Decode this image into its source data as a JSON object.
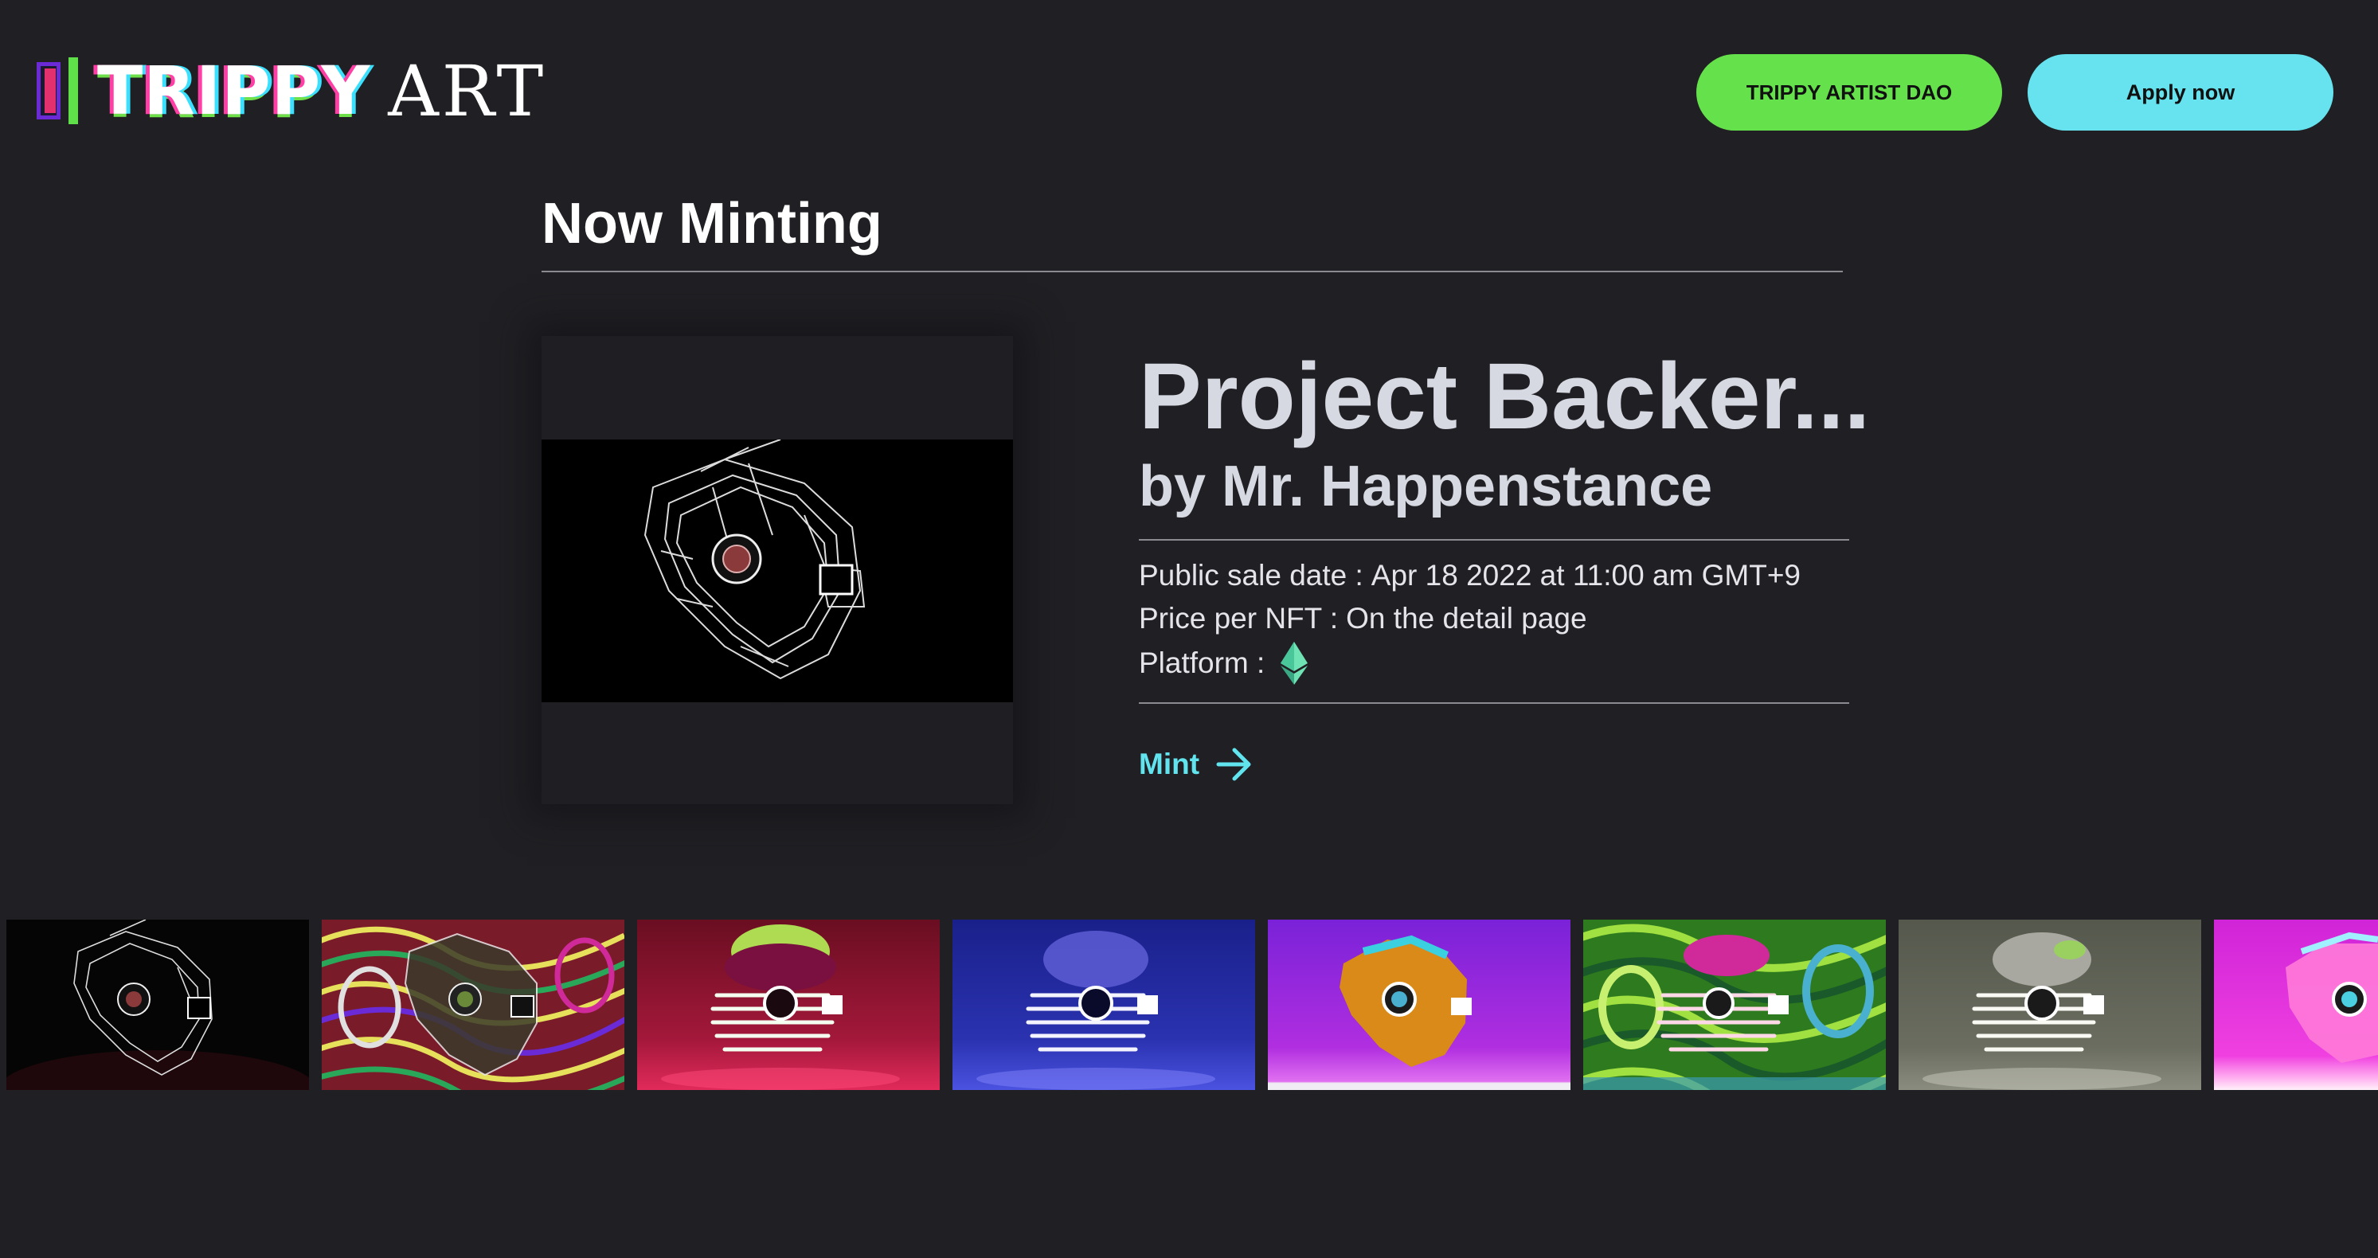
{
  "header": {
    "logo_word_1": "TRIPPY",
    "logo_word_2": "ART",
    "dao_button": "TRIPPY ARTIST DAO",
    "apply_button": "Apply now"
  },
  "section": {
    "title": "Now Minting"
  },
  "feature": {
    "title": "Project Backer...",
    "artist": "by Mr. Happenstance",
    "sale_label": "Public sale date :",
    "sale_value": "Apr 18 2022 at 11:00 am GMT+9",
    "price_label": "Price per NFT :",
    "price_value": "On the detail page",
    "platform_label": "Platform :",
    "platform_icon": "ethereum-icon",
    "mint_label": "Mint"
  },
  "thumbnails": [
    {
      "name": "sketch-black",
      "bg": "#050505",
      "accent": "#d8d8d8"
    },
    {
      "name": "swirl-rainbow",
      "bg": "#7a1b2a",
      "accent": "#e6e05a"
    },
    {
      "name": "red-neon",
      "bg": "#8a1230",
      "accent": "#b8ff5a"
    },
    {
      "name": "blue-neon",
      "bg": "#1f2a9a",
      "accent": "#6a6aff"
    },
    {
      "name": "purple-gold",
      "bg": "#8a2ee0",
      "accent": "#d98a18"
    },
    {
      "name": "green-swirl",
      "bg": "#3a8a20",
      "accent": "#d02a9a"
    },
    {
      "name": "grey-neon",
      "bg": "#5e6154",
      "accent": "#9a9a9a"
    },
    {
      "name": "pink-neon",
      "bg": "#e02ee0",
      "accent": "#ff6ad0"
    }
  ],
  "colors": {
    "background": "#202024",
    "dao_green": "#65e24b",
    "apply_cyan": "#66e3ee",
    "mint_cyan": "#61e4ee"
  }
}
